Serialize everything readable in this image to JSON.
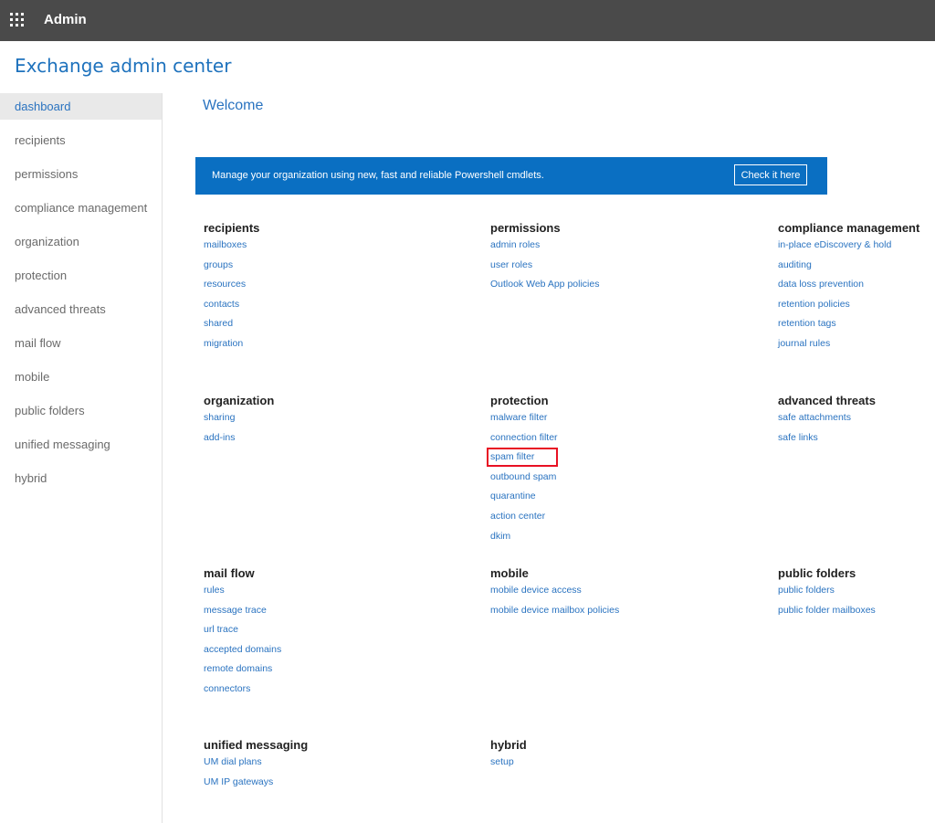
{
  "topbar": {
    "title": "Admin",
    "menu_icon": "app-launcher-icon"
  },
  "app_title": "Exchange admin center",
  "sidebar": {
    "items": [
      {
        "label": "dashboard",
        "active": true
      },
      {
        "label": "recipients"
      },
      {
        "label": "permissions"
      },
      {
        "label": "compliance management"
      },
      {
        "label": "organization"
      },
      {
        "label": "protection"
      },
      {
        "label": "advanced threats"
      },
      {
        "label": "mail flow"
      },
      {
        "label": "mobile"
      },
      {
        "label": "public folders"
      },
      {
        "label": "unified messaging"
      },
      {
        "label": "hybrid"
      }
    ]
  },
  "main": {
    "welcome": "Welcome",
    "banner": {
      "text": "Manage your organization using new, fast and reliable Powershell cmdlets.",
      "button": "Check it here"
    },
    "sections": [
      {
        "heading": "recipients",
        "links": [
          "mailboxes",
          "groups",
          "resources",
          "contacts",
          "shared",
          "migration"
        ]
      },
      {
        "heading": "permissions",
        "links": [
          "admin roles",
          "user roles",
          "Outlook Web App policies"
        ]
      },
      {
        "heading": "compliance management",
        "links": [
          "in-place eDiscovery & hold",
          "auditing",
          "data loss prevention",
          "retention policies",
          "retention tags",
          "journal rules"
        ]
      },
      {
        "heading": "organization",
        "links": [
          "sharing",
          "add-ins"
        ]
      },
      {
        "heading": "protection",
        "links": [
          "malware filter",
          "connection filter",
          "spam filter",
          "outbound spam",
          "quarantine",
          "action center",
          "dkim"
        ]
      },
      {
        "heading": "advanced threats",
        "links": [
          "safe attachments",
          "safe links"
        ]
      },
      {
        "heading": "mail flow",
        "links": [
          "rules",
          "message trace",
          "url trace",
          "accepted domains",
          "remote domains",
          "connectors"
        ]
      },
      {
        "heading": "mobile",
        "links": [
          "mobile device access",
          "mobile device mailbox policies"
        ]
      },
      {
        "heading": "public folders",
        "links": [
          "public folders",
          "public folder mailboxes"
        ]
      },
      {
        "heading": "unified messaging",
        "links": [
          "UM dial plans",
          "UM IP gateways"
        ]
      },
      {
        "heading": "hybrid",
        "links": [
          "setup"
        ]
      }
    ]
  },
  "colors": {
    "topbar": "#4a4a4a",
    "link": "#2a73c0",
    "banner": "#0a6fc2",
    "highlight": "#e81123"
  }
}
